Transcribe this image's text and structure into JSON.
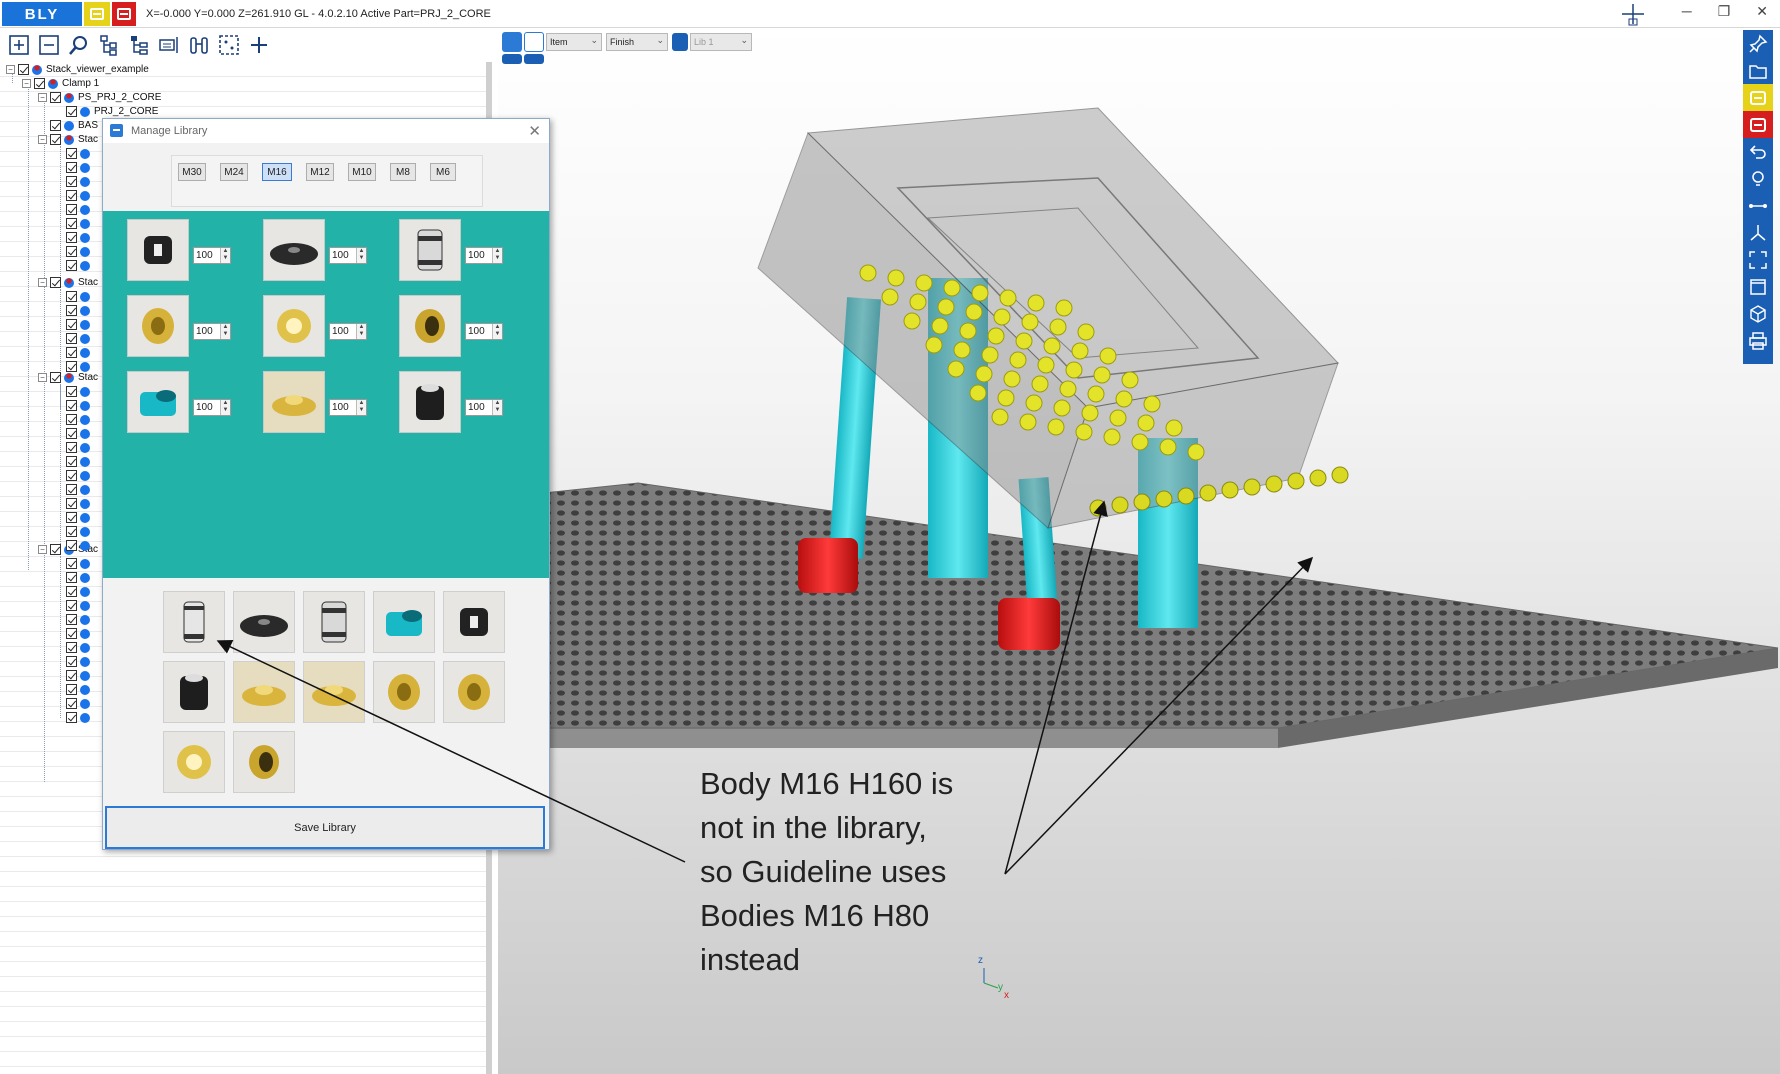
{
  "title_bar": {
    "logo": "BLY",
    "status": "X=-0.000 Y=0.000 Z=261.910    GL - 4.0.2.10 Active Part=PRJ_2_CORE"
  },
  "tree": {
    "nodes": [
      {
        "label": "Stack_viewer_example"
      },
      {
        "label": "Clamp 1"
      },
      {
        "label": "PS_PRJ_2_CORE"
      },
      {
        "label": "PRJ_2_CORE"
      },
      {
        "label": "BAS"
      },
      {
        "label": "Stac"
      },
      {
        "label": "Stac"
      },
      {
        "label": "Stac"
      },
      {
        "label": "Stac"
      }
    ]
  },
  "dialog": {
    "title": "Manage Library",
    "sizes": [
      "M30",
      "M24",
      "M16",
      "M12",
      "M10",
      "M8",
      "M6"
    ],
    "active_size": "M16",
    "quantities": [
      "100",
      "100",
      "100",
      "100",
      "100",
      "100",
      "100",
      "100",
      "100"
    ],
    "save_label": "Save Library"
  },
  "view_toolbar": {
    "select1": "Item",
    "select2": "Finish",
    "select3": "Lib 1"
  },
  "axis": {
    "z": "z",
    "y": "y",
    "x": "x"
  },
  "annotation": "Body M16 H160 is\nnot in the library,\nso Guideline uses\nBodies M16 H80\ninstead",
  "colors": {
    "accent_blue": "#1a73d9",
    "yellow": "#e7d21a",
    "red": "#d71e1e",
    "teal_panel": "#22b2a8",
    "support_cyan": "#2ed3de"
  }
}
